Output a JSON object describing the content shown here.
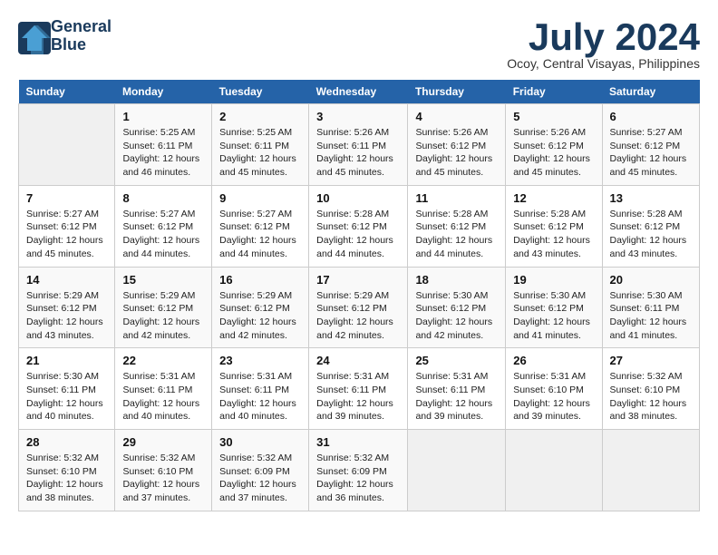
{
  "logo": {
    "line1": "General",
    "line2": "Blue"
  },
  "title": "July 2024",
  "location": "Ocoy, Central Visayas, Philippines",
  "weekdays": [
    "Sunday",
    "Monday",
    "Tuesday",
    "Wednesday",
    "Thursday",
    "Friday",
    "Saturday"
  ],
  "weeks": [
    [
      {
        "day": "",
        "sunrise": "",
        "sunset": "",
        "daylight": ""
      },
      {
        "day": "1",
        "sunrise": "Sunrise: 5:25 AM",
        "sunset": "Sunset: 6:11 PM",
        "daylight": "Daylight: 12 hours and 46 minutes."
      },
      {
        "day": "2",
        "sunrise": "Sunrise: 5:25 AM",
        "sunset": "Sunset: 6:11 PM",
        "daylight": "Daylight: 12 hours and 45 minutes."
      },
      {
        "day": "3",
        "sunrise": "Sunrise: 5:26 AM",
        "sunset": "Sunset: 6:11 PM",
        "daylight": "Daylight: 12 hours and 45 minutes."
      },
      {
        "day": "4",
        "sunrise": "Sunrise: 5:26 AM",
        "sunset": "Sunset: 6:12 PM",
        "daylight": "Daylight: 12 hours and 45 minutes."
      },
      {
        "day": "5",
        "sunrise": "Sunrise: 5:26 AM",
        "sunset": "Sunset: 6:12 PM",
        "daylight": "Daylight: 12 hours and 45 minutes."
      },
      {
        "day": "6",
        "sunrise": "Sunrise: 5:27 AM",
        "sunset": "Sunset: 6:12 PM",
        "daylight": "Daylight: 12 hours and 45 minutes."
      }
    ],
    [
      {
        "day": "7",
        "sunrise": "Sunrise: 5:27 AM",
        "sunset": "Sunset: 6:12 PM",
        "daylight": "Daylight: 12 hours and 45 minutes."
      },
      {
        "day": "8",
        "sunrise": "Sunrise: 5:27 AM",
        "sunset": "Sunset: 6:12 PM",
        "daylight": "Daylight: 12 hours and 44 minutes."
      },
      {
        "day": "9",
        "sunrise": "Sunrise: 5:27 AM",
        "sunset": "Sunset: 6:12 PM",
        "daylight": "Daylight: 12 hours and 44 minutes."
      },
      {
        "day": "10",
        "sunrise": "Sunrise: 5:28 AM",
        "sunset": "Sunset: 6:12 PM",
        "daylight": "Daylight: 12 hours and 44 minutes."
      },
      {
        "day": "11",
        "sunrise": "Sunrise: 5:28 AM",
        "sunset": "Sunset: 6:12 PM",
        "daylight": "Daylight: 12 hours and 44 minutes."
      },
      {
        "day": "12",
        "sunrise": "Sunrise: 5:28 AM",
        "sunset": "Sunset: 6:12 PM",
        "daylight": "Daylight: 12 hours and 43 minutes."
      },
      {
        "day": "13",
        "sunrise": "Sunrise: 5:28 AM",
        "sunset": "Sunset: 6:12 PM",
        "daylight": "Daylight: 12 hours and 43 minutes."
      }
    ],
    [
      {
        "day": "14",
        "sunrise": "Sunrise: 5:29 AM",
        "sunset": "Sunset: 6:12 PM",
        "daylight": "Daylight: 12 hours and 43 minutes."
      },
      {
        "day": "15",
        "sunrise": "Sunrise: 5:29 AM",
        "sunset": "Sunset: 6:12 PM",
        "daylight": "Daylight: 12 hours and 42 minutes."
      },
      {
        "day": "16",
        "sunrise": "Sunrise: 5:29 AM",
        "sunset": "Sunset: 6:12 PM",
        "daylight": "Daylight: 12 hours and 42 minutes."
      },
      {
        "day": "17",
        "sunrise": "Sunrise: 5:29 AM",
        "sunset": "Sunset: 6:12 PM",
        "daylight": "Daylight: 12 hours and 42 minutes."
      },
      {
        "day": "18",
        "sunrise": "Sunrise: 5:30 AM",
        "sunset": "Sunset: 6:12 PM",
        "daylight": "Daylight: 12 hours and 42 minutes."
      },
      {
        "day": "19",
        "sunrise": "Sunrise: 5:30 AM",
        "sunset": "Sunset: 6:12 PM",
        "daylight": "Daylight: 12 hours and 41 minutes."
      },
      {
        "day": "20",
        "sunrise": "Sunrise: 5:30 AM",
        "sunset": "Sunset: 6:11 PM",
        "daylight": "Daylight: 12 hours and 41 minutes."
      }
    ],
    [
      {
        "day": "21",
        "sunrise": "Sunrise: 5:30 AM",
        "sunset": "Sunset: 6:11 PM",
        "daylight": "Daylight: 12 hours and 40 minutes."
      },
      {
        "day": "22",
        "sunrise": "Sunrise: 5:31 AM",
        "sunset": "Sunset: 6:11 PM",
        "daylight": "Daylight: 12 hours and 40 minutes."
      },
      {
        "day": "23",
        "sunrise": "Sunrise: 5:31 AM",
        "sunset": "Sunset: 6:11 PM",
        "daylight": "Daylight: 12 hours and 40 minutes."
      },
      {
        "day": "24",
        "sunrise": "Sunrise: 5:31 AM",
        "sunset": "Sunset: 6:11 PM",
        "daylight": "Daylight: 12 hours and 39 minutes."
      },
      {
        "day": "25",
        "sunrise": "Sunrise: 5:31 AM",
        "sunset": "Sunset: 6:11 PM",
        "daylight": "Daylight: 12 hours and 39 minutes."
      },
      {
        "day": "26",
        "sunrise": "Sunrise: 5:31 AM",
        "sunset": "Sunset: 6:10 PM",
        "daylight": "Daylight: 12 hours and 39 minutes."
      },
      {
        "day": "27",
        "sunrise": "Sunrise: 5:32 AM",
        "sunset": "Sunset: 6:10 PM",
        "daylight": "Daylight: 12 hours and 38 minutes."
      }
    ],
    [
      {
        "day": "28",
        "sunrise": "Sunrise: 5:32 AM",
        "sunset": "Sunset: 6:10 PM",
        "daylight": "Daylight: 12 hours and 38 minutes."
      },
      {
        "day": "29",
        "sunrise": "Sunrise: 5:32 AM",
        "sunset": "Sunset: 6:10 PM",
        "daylight": "Daylight: 12 hours and 37 minutes."
      },
      {
        "day": "30",
        "sunrise": "Sunrise: 5:32 AM",
        "sunset": "Sunset: 6:09 PM",
        "daylight": "Daylight: 12 hours and 37 minutes."
      },
      {
        "day": "31",
        "sunrise": "Sunrise: 5:32 AM",
        "sunset": "Sunset: 6:09 PM",
        "daylight": "Daylight: 12 hours and 36 minutes."
      },
      {
        "day": "",
        "sunrise": "",
        "sunset": "",
        "daylight": ""
      },
      {
        "day": "",
        "sunrise": "",
        "sunset": "",
        "daylight": ""
      },
      {
        "day": "",
        "sunrise": "",
        "sunset": "",
        "daylight": ""
      }
    ]
  ]
}
